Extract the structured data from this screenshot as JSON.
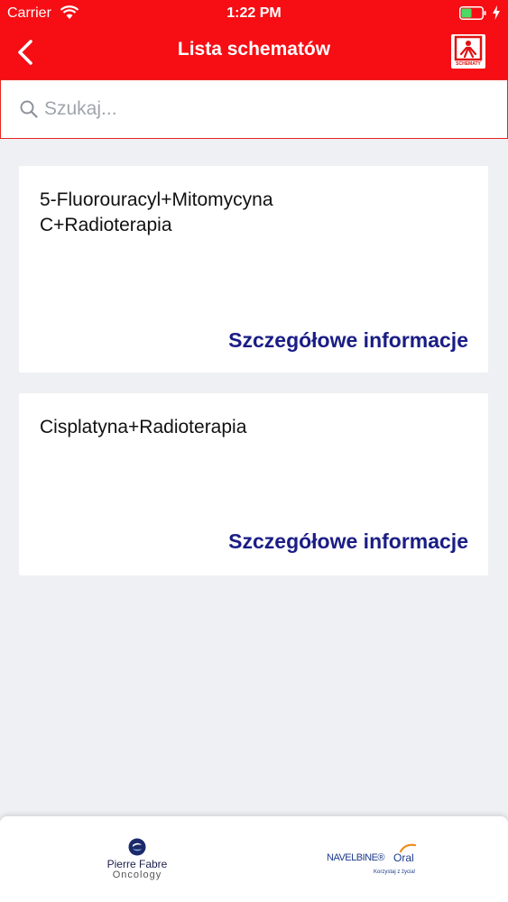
{
  "status_bar": {
    "carrier": "Carrier",
    "time": "1:22 PM",
    "battery_level": 0.5,
    "battery_color": "#4cd964"
  },
  "nav": {
    "back_icon": "chevron-left-icon",
    "title": "Lista schematów",
    "logo_label": "SCHEMATY",
    "bar_color": "#f60e14"
  },
  "search": {
    "placeholder": "Szukaj...",
    "value": "",
    "icon": "search-icon"
  },
  "schemes": [
    {
      "title": "5-Fluorouracyl+Mitomycyna C+Radioterapia",
      "link_label": "Szczegółowe informacje"
    },
    {
      "title": "Cisplatyna+Radioterapia",
      "link_label": "Szczegółowe informacje"
    }
  ],
  "footer": {
    "pierre_fabre": {
      "name": "Pierre Fabre",
      "sub": "Oncology"
    },
    "navelbine": {
      "name": "NAVELBINE®",
      "oral": "Oral",
      "tagline": "Korzystaj z życia!"
    }
  },
  "colors": {
    "link": "#1a1d84",
    "background": "#eef0f4"
  }
}
